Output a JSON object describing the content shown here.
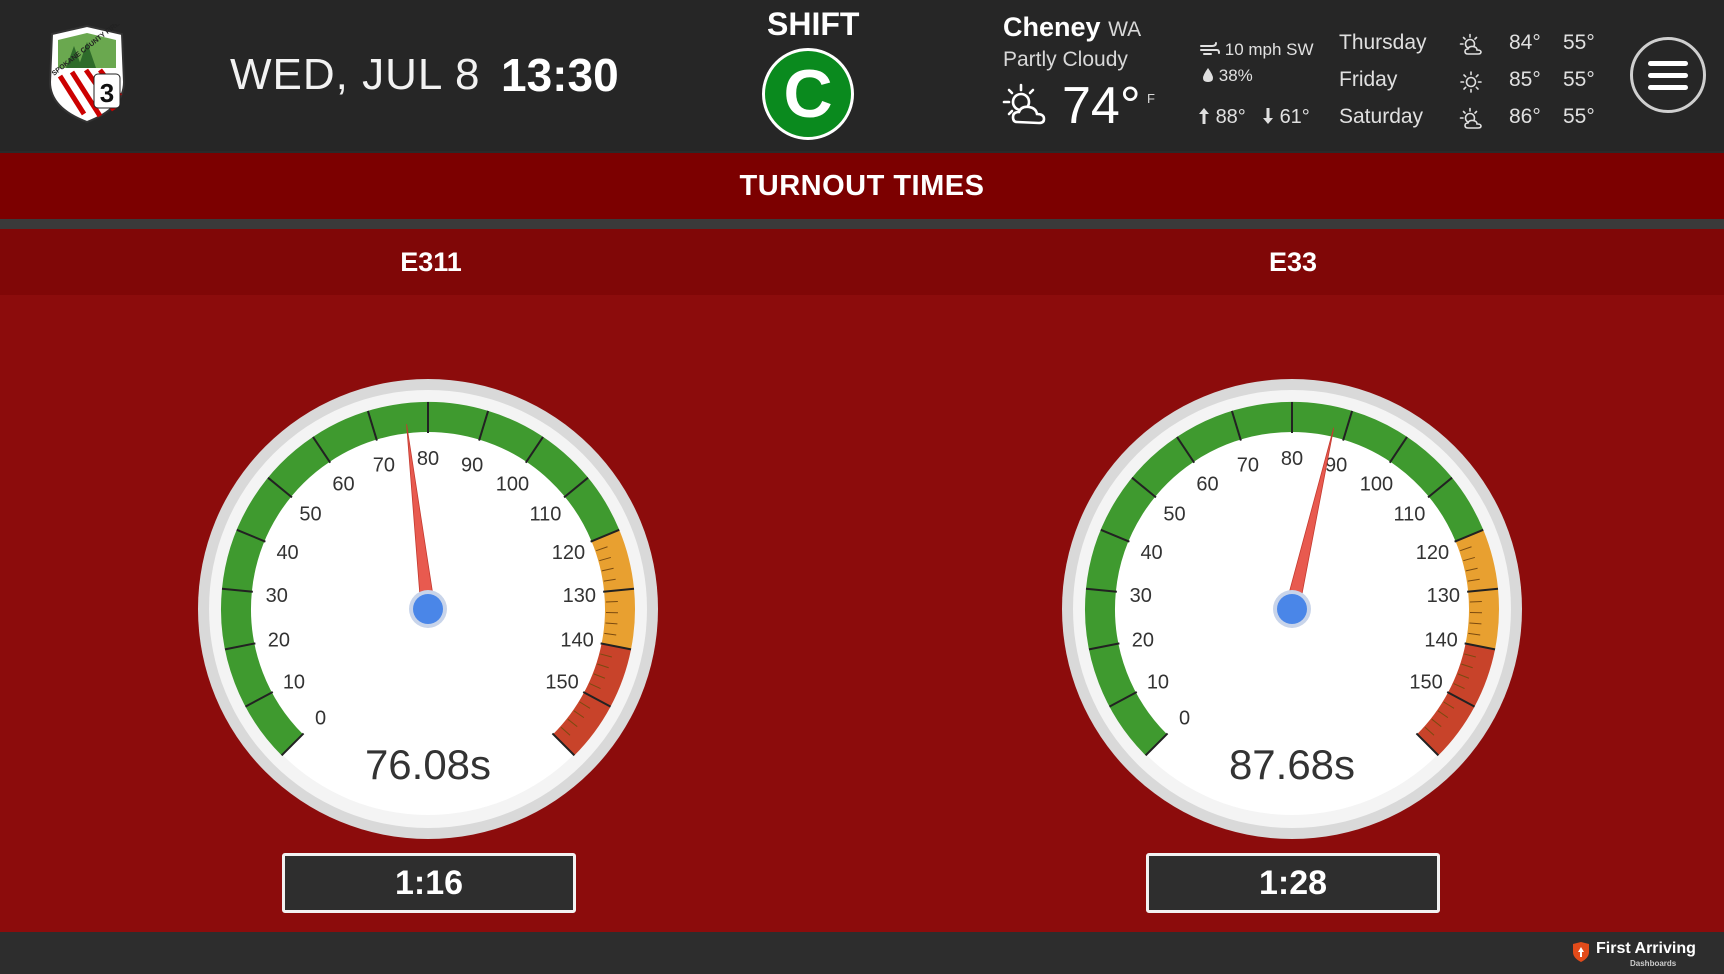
{
  "header": {
    "logo_text": "SPOKANE COUNTY FIRE DISTRICT",
    "logo_number": "3",
    "date": "WED, JUL 8",
    "time": "13:30",
    "shift_label": "SHIFT",
    "shift_value": "C",
    "shift_color": "#0a8a1e"
  },
  "weather": {
    "city": "Cheney",
    "state": "WA",
    "condition": "Partly Cloudy",
    "temperature": "74°",
    "unit": "F",
    "wind": "10 mph SW",
    "humidity": "38%",
    "high": "88°",
    "low": "61°",
    "forecast": [
      {
        "day": "Thursday",
        "icon": "partly-sunny-icon",
        "high": "84°",
        "low": "55°"
      },
      {
        "day": "Friday",
        "icon": "sunny-icon",
        "high": "85°",
        "low": "55°"
      },
      {
        "day": "Saturday",
        "icon": "partly-sunny-icon",
        "high": "86°",
        "low": "55°"
      }
    ]
  },
  "title": "TURNOUT TIMES",
  "units": [
    {
      "name": "E311",
      "value": 76.08,
      "value_label": "76.08s",
      "readout": "1:16"
    },
    {
      "name": "E33",
      "value": 87.68,
      "value_label": "87.68s",
      "readout": "1:28"
    }
  ],
  "chart_data": {
    "type": "gauge",
    "min": 0,
    "max": 160,
    "tick_labels": [
      "0",
      "10",
      "20",
      "30",
      "40",
      "50",
      "60",
      "70",
      "80",
      "90",
      "100",
      "110",
      "120",
      "130",
      "140",
      "150"
    ],
    "bands": [
      {
        "from": 0,
        "to": 120,
        "color": "#3f9a2f"
      },
      {
        "from": 120,
        "to": 140,
        "color": "#e8a030"
      },
      {
        "from": 140,
        "to": 160,
        "color": "#c8432a"
      }
    ],
    "series": [
      {
        "values": [
          76.08
        ]
      },
      {
        "values": [
          87.68
        ]
      }
    ]
  },
  "footer": {
    "brand_name": "First Arriving",
    "brand_sub": "Dashboards"
  },
  "colors": {
    "header_bg": "#262626",
    "title_bg": "#7c0000",
    "panel_bg": "#8c0c0c",
    "needle": "#e85a4f",
    "hub": "#4a86e8"
  }
}
